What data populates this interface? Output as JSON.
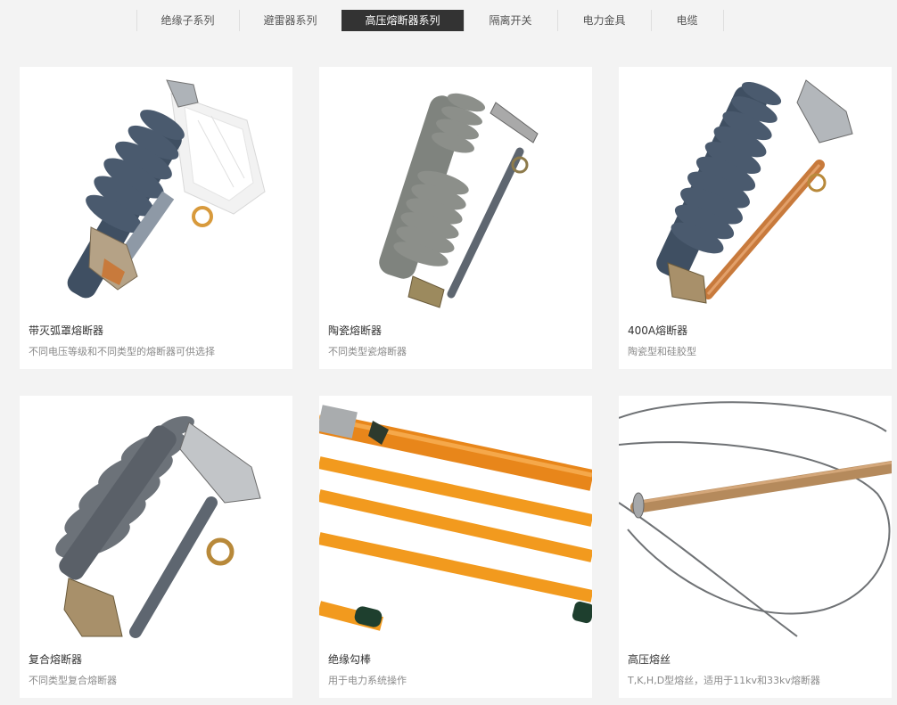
{
  "tabs": [
    {
      "label": "绝缘子系列",
      "active": false
    },
    {
      "label": "避雷器系列",
      "active": false
    },
    {
      "label": "高压熔断器系列",
      "active": true
    },
    {
      "label": "隔离开关",
      "active": false
    },
    {
      "label": "电力金具",
      "active": false
    },
    {
      "label": "电缆",
      "active": false
    }
  ],
  "products": [
    {
      "title": "带灭弧罩熔断器",
      "desc": "不同电压等级和不同类型的熔断器可供选择"
    },
    {
      "title": "陶瓷熔断器",
      "desc": "不同类型瓷熔断器"
    },
    {
      "title": "400A熔断器",
      "desc": "陶瓷型和硅胶型"
    },
    {
      "title": "复合熔断器",
      "desc": "不同类型复合熔断器"
    },
    {
      "title": "绝缘勾棒",
      "desc": "用于电力系统操作"
    },
    {
      "title": "高压熔丝",
      "desc": "T,K,H,D型熔丝，适用于11kv和33kv熔断器"
    }
  ],
  "colors": {
    "page_bg": "#f3f3f3",
    "active_tab_bg": "#333333",
    "insulator_blue": "#4a5a6e",
    "porcelain_gray": "#8c8f8a",
    "copper": "#c87a3c",
    "rod_orange": "#f29a1e"
  }
}
